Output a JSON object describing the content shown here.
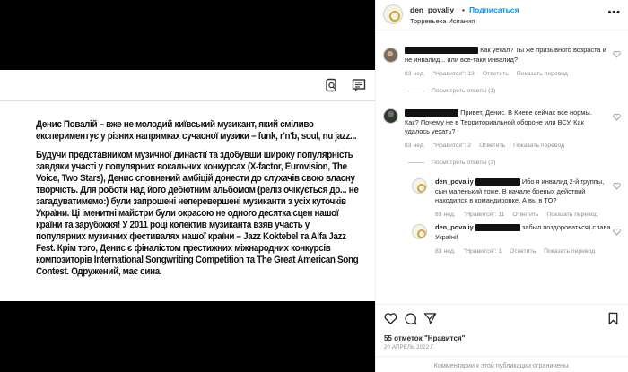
{
  "post": {
    "article_paragraphs": [
      "Денис Повалій – вже не молодий київський музикант, який сміливо експериментує у різних напрямках сучасної музики – funk, r'n'b, soul, nu jazz...",
      "Будучи представником музичної династії та здобувши широку популярність завдяки участі у популярних вокальних конкурсах (X-factor, Eurovision, The Voice, Two Stars), Денис сповнений амбіцій донести до слухачів свою власну творчість. Для роботи над його дебютним альбомом (реліз очікується до... не загадуватимемо:) були запрошені неперевершені музиканти з усіх куточків України. Ці іменитні майстри були окрасою не одного десятка сцен нашої країни та зарубіжжя! У 2011 році колектив музиканта взяв участь у популярних музичних фестивалях нашої країни – Jazz Koktebel та Alfa Jazz Fest. Крім того, Денис є фіналістом престижних міжнародних конкурсів композиторів International Songwriting Competition та The Great American Song Contest. Одружений, має сина."
    ]
  },
  "header": {
    "username": "den_povaliy",
    "separator": "•",
    "follow_label": "Подписаться",
    "location": "Торревьеха Испания",
    "more_icon": "more-horizontal-icon"
  },
  "comments": [
    {
      "text": "Как уехал? Ты же призывного возраста и не инвалид... или все-таки инвалид?",
      "meta": {
        "age": "83 нед.",
        "likes": "\"Нравится\": 13",
        "reply": "Ответить",
        "translate": "Показать перевод"
      },
      "replies": "Посмотреть ответы (1)"
    },
    {
      "text": "Привет, Денис. В Киеве сейчас все нормы. Как? Почему не в Территориальной обороне или ВСУ. Как удалось уехать?",
      "meta": {
        "age": "83 нед.",
        "likes": "\"Нравится\": 2",
        "reply": "Ответить",
        "translate": "Показать перевод"
      },
      "replies": "Посмотреть ответы (3)"
    },
    {
      "username": "den_povaliy",
      "text": "Ибо я инвалид 2-й группы, сын маленький тоже. В начале боевых действий находился в командировке. А вы в ТО?",
      "meta": {
        "age": "83 нед.",
        "likes": "\"Нравится\": 11",
        "reply": "Ответить",
        "translate": "Показать перевод"
      }
    },
    {
      "username": "den_povaliy",
      "text": "забыл поздороваться) слава Україні!",
      "meta": {
        "age": "83 нед.",
        "likes": "\"Нравится\": 1",
        "reply": "Ответить",
        "translate": "Показать перевод"
      }
    }
  ],
  "actions": {
    "likes_count": "55 отметок",
    "likes_label": "\"Нравится\"",
    "date": "20 АПРЕЛЬ 2022 Г.",
    "comments_disabled": "Комментарии к этой публикации ограничены."
  }
}
